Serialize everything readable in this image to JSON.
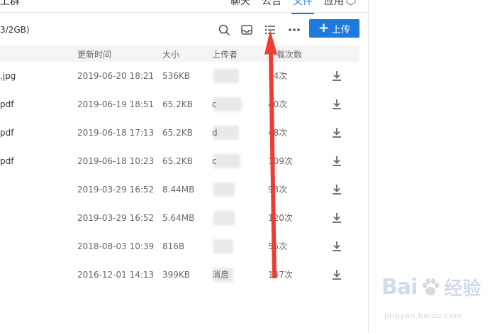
{
  "header": {
    "title_fragment": "上群",
    "tabs": [
      {
        "label": "聊天"
      },
      {
        "label": "公告"
      },
      {
        "label": "文件"
      },
      {
        "label": "应用"
      }
    ],
    "accent_color": "#1f7ae0"
  },
  "toolbar": {
    "quota_text": "3/2GB)",
    "icons": [
      "search-icon",
      "inbox-icon",
      "list-view-icon",
      "more-icon"
    ],
    "upload_label": "上传",
    "upload_icon": "plus-icon"
  },
  "table": {
    "columns": [
      "更新时间",
      "大小",
      "上传者",
      "下载次数"
    ],
    "rows": [
      {
        "name": ".jpg",
        "date": "2019-06-20 18:21",
        "size": "536KB",
        "uploader": "",
        "count": "14次"
      },
      {
        "name": "pdf",
        "date": "2019-06-19 18:51",
        "size": "65.2KB",
        "uploader": "c",
        "count": "40次"
      },
      {
        "name": "pdf",
        "date": "2019-06-18 17:13",
        "size": "65.2KB",
        "uploader": "d",
        "count": "48次"
      },
      {
        "name": "pdf",
        "date": "2019-06-18 10:23",
        "size": "65.2KB",
        "uploader": "c",
        "count": "109次"
      },
      {
        "name": "",
        "date": "2019-03-29 16:52",
        "size": "8.44MB",
        "uploader": "",
        "count": "93次"
      },
      {
        "name": "",
        "date": "2019-03-29 16:52",
        "size": "5.64MB",
        "uploader": "",
        "count": "120次"
      },
      {
        "name": "",
        "date": "2018-08-03 10:39",
        "size": "816B",
        "uploader": "",
        "count": "55次"
      },
      {
        "name": "",
        "date": "2016-12-01 14:13",
        "size": "399KB",
        "uploader": "消息",
        "count": "147次"
      }
    ]
  },
  "annotation": {
    "color": "#ee3b33",
    "icon": "red-arrow"
  },
  "watermark": {
    "brand": "Bai",
    "brand_suffix": "经验",
    "url": "jingyan.baidu.com"
  }
}
